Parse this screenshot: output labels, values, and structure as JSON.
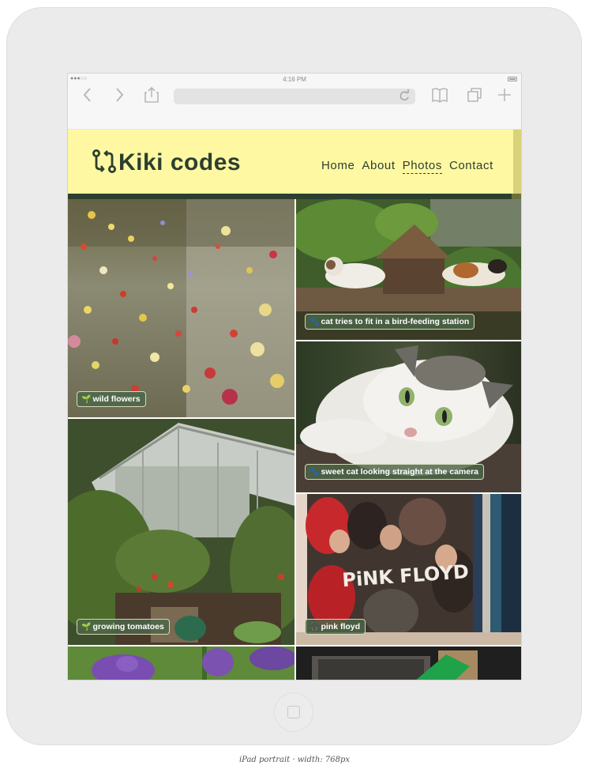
{
  "status_bar": {
    "signal": "●●●○○",
    "time": "4:16 PM"
  },
  "browser": {
    "back_icon": "chevron-left-icon",
    "forward_icon": "chevron-right-icon",
    "share_icon": "share-icon",
    "reload_icon": "reload-icon",
    "bookmarks_icon": "book-icon",
    "tabs_icon": "tabs-icon",
    "new_tab_icon": "plus-icon"
  },
  "site": {
    "logo_icon": "code-branch-icon",
    "title": "Kiki codes",
    "nav": [
      {
        "label": "Home",
        "active": false
      },
      {
        "label": "About",
        "active": false
      },
      {
        "label": "Photos",
        "active": true
      },
      {
        "label": "Contact",
        "active": false
      }
    ]
  },
  "photos": [
    {
      "subject": "wild flowers",
      "caption": "wild flowers",
      "caption_icon": "seedling-icon"
    },
    {
      "subject": "cat bird house",
      "caption": "cat tries to fit in a bird-feeding station",
      "caption_icon": "paw-icon"
    },
    {
      "subject": "sweet cat",
      "caption": "sweet cat looking straight at the camera",
      "caption_icon": "paw-icon"
    },
    {
      "subject": "greenhouse",
      "caption": "growing tomatoes",
      "caption_icon": "seedling-icon"
    },
    {
      "subject": "pink floyd record",
      "caption": "pink floyd",
      "caption_icon": "headphones-icon"
    }
  ],
  "device_label": "iPad portrait · width: 768px",
  "colors": {
    "header_bg": "#fff8a3",
    "brand_dark": "#2c3f2f",
    "caption_bg": "#4c6648"
  }
}
